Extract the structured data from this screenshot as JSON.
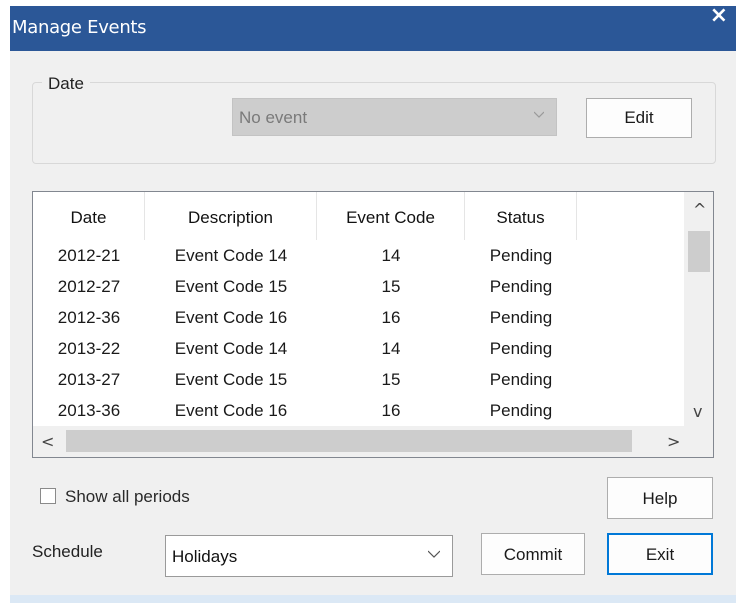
{
  "window": {
    "title": "Manage Events",
    "close_glyph": "×"
  },
  "date_group": {
    "legend": "Date",
    "event_select": {
      "value": "No event",
      "disabled": true
    },
    "edit_label": "Edit"
  },
  "table": {
    "columns": [
      "Date",
      "Description",
      "Event Code",
      "Status"
    ],
    "rows": [
      [
        "2012-21",
        "Event Code 14",
        "14",
        "Pending"
      ],
      [
        "2012-27",
        "Event Code 15",
        "15",
        "Pending"
      ],
      [
        "2012-36",
        "Event Code 16",
        "16",
        "Pending"
      ],
      [
        "2013-22",
        "Event Code 14",
        "14",
        "Pending"
      ],
      [
        "2013-27",
        "Event Code 15",
        "15",
        "Pending"
      ],
      [
        "2013-36",
        "Event Code 16",
        "16",
        "Pending"
      ]
    ],
    "scroll": {
      "up": "^",
      "down": "v",
      "left": "<",
      "right": ">"
    }
  },
  "options": {
    "show_all_periods_label": "Show all periods",
    "show_all_periods_checked": false
  },
  "buttons": {
    "help": "Help",
    "commit": "Commit",
    "exit": "Exit"
  },
  "schedule": {
    "label": "Schedule",
    "value": "Holidays"
  },
  "colors": {
    "titlebar": "#2b5797",
    "dialog_bg": "#f0f0f0",
    "focus_border": "#0078d7"
  }
}
